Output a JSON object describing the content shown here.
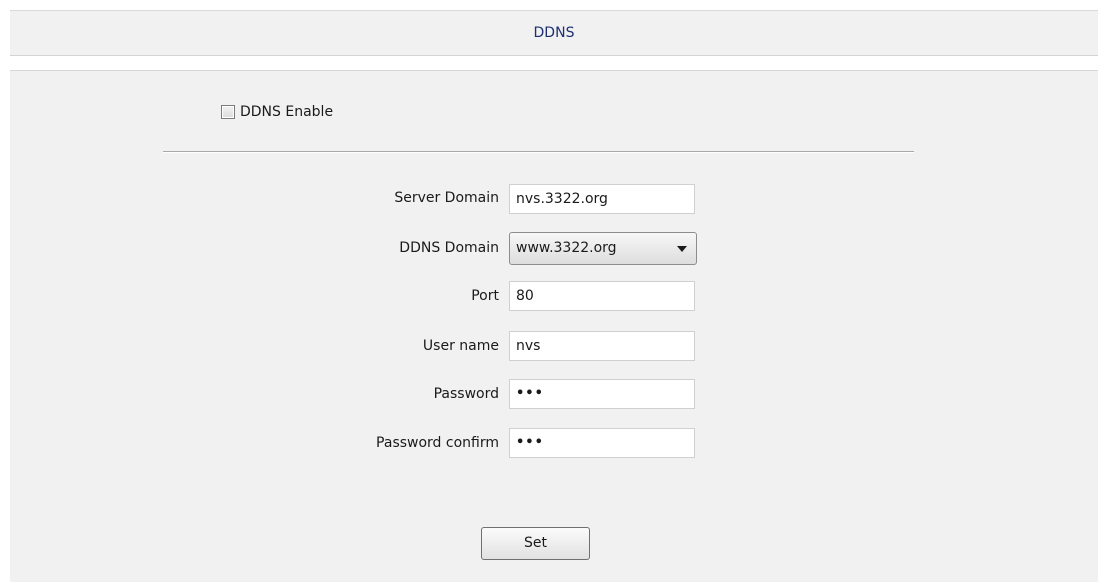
{
  "header": {
    "title": "DDNS"
  },
  "ddns_enable": {
    "label": "DDNS Enable",
    "checked": false
  },
  "form": {
    "server_domain": {
      "label": "Server Domain",
      "value": "nvs.3322.org"
    },
    "ddns_domain": {
      "label": "DDNS Domain",
      "selected": "www.3322.org"
    },
    "port": {
      "label": "Port",
      "value": "80"
    },
    "user_name": {
      "label": "User name",
      "value": "nvs"
    },
    "password": {
      "label": "Password",
      "value": "•••"
    },
    "password_confirm": {
      "label": "Password confirm",
      "value": "•••"
    }
  },
  "actions": {
    "set_label": "Set"
  }
}
